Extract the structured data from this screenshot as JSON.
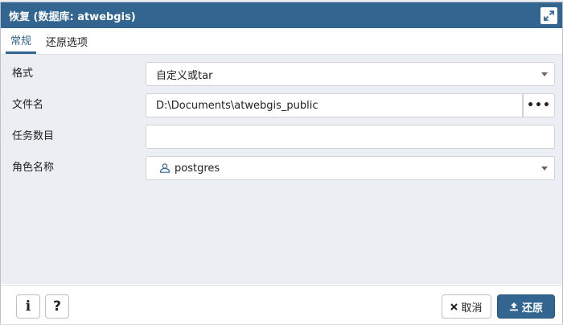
{
  "dialog": {
    "title": "恢复 (数据库: atwebgis)"
  },
  "tabs": [
    {
      "label": "常规",
      "active": true
    },
    {
      "label": "还原选项",
      "active": false
    }
  ],
  "form": {
    "format": {
      "label": "格式",
      "value": "自定义或tar"
    },
    "filename": {
      "label": "文件名",
      "value": "D:\\Documents\\atwebgis_public",
      "browse_label": "•••"
    },
    "jobs": {
      "label": "任务数目",
      "value": ""
    },
    "role": {
      "label": "角色名称",
      "value": "postgres",
      "icon": "user-icon"
    }
  },
  "footer": {
    "info_label": "i",
    "help_label": "?",
    "cancel_label": "取消",
    "restore_label": "还原"
  },
  "colors": {
    "titlebar": "#326690",
    "body_bg": "#ebeef3",
    "primary_button": "#326690"
  }
}
